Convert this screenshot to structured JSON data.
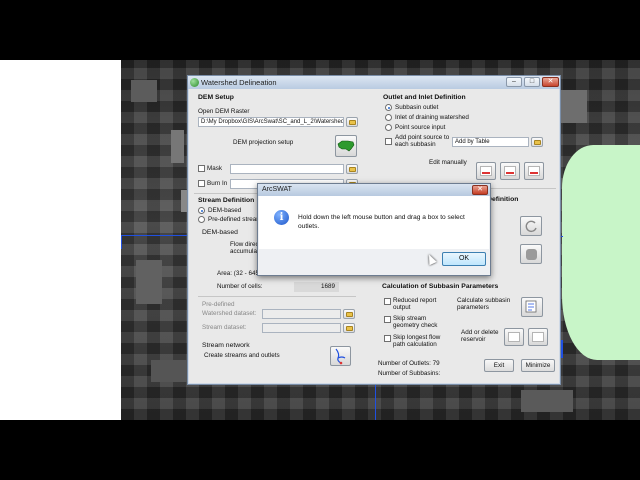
{
  "dialog": {
    "title": "Watershed Delineation",
    "title_buttons": {
      "minimize": "–",
      "restore": "□",
      "close": "✕"
    }
  },
  "dem_setup": {
    "heading": "DEM Setup",
    "open_dem_label": "Open DEM Raster",
    "dem_path": "D:\\My Dropbox\\GIS\\ArcSwat\\SC_and_L_2\\Watershed\\G",
    "projection_setup": "DEM projection setup",
    "mask_label": "Mask",
    "burn_in_label": "Burn In"
  },
  "outlet_inlet": {
    "heading": "Outlet and Inlet Definition",
    "options": [
      "Subbasin outlet",
      "Inlet of draining watershed",
      "Point source input"
    ],
    "selected": 0,
    "add_point_source": "Add point source to each subbasin",
    "add_by_table": "Add by Table",
    "edit_manually": "Edit manually"
  },
  "stream_definition": {
    "heading": "Stream Definition",
    "dem_based": "DEM-based",
    "predefined": "Pre-defined stream",
    "dem_based_label": "DEM-based",
    "flow_direction": "Flow direc",
    "accumulation": "accumulati",
    "area_label": "Area: (32 - 6450",
    "cells_label": "Number of cells:",
    "cells_value": "1689",
    "predefined_section": "Pre-defined",
    "watershed_dataset": "Watershed dataset:",
    "stream_dataset": "Stream dataset:",
    "stream_network": "Stream network",
    "create_streams": "Create streams and outlets"
  },
  "outlet_selection": {
    "heading_fragment": "d Definition"
  },
  "subbasin_params": {
    "heading": "Calculation of Subbasin Parameters",
    "reduced_report": "Reduced  report output",
    "skip_stream": "Skip stream geometry check",
    "skip_longest": "Skip longest flow path calculation",
    "calculate": "Calculate subbasin parameters",
    "add_delete_reservoir": "Add or delete reservoir",
    "outlets_count": "Number of Outlets: 79",
    "subbasins_count": "Number of Subbasins:"
  },
  "footer": {
    "exit": "Exit",
    "minimize": "Minimize"
  },
  "message_box": {
    "title": "ArcSWAT",
    "close": "✕",
    "text": "Hold down the left mouse button and drag a box to select outlets.",
    "ok": "OK"
  },
  "colors": {
    "watershed": "#c8f5c8",
    "river": "#2050e0",
    "titlebar": "#b9cbe1"
  }
}
